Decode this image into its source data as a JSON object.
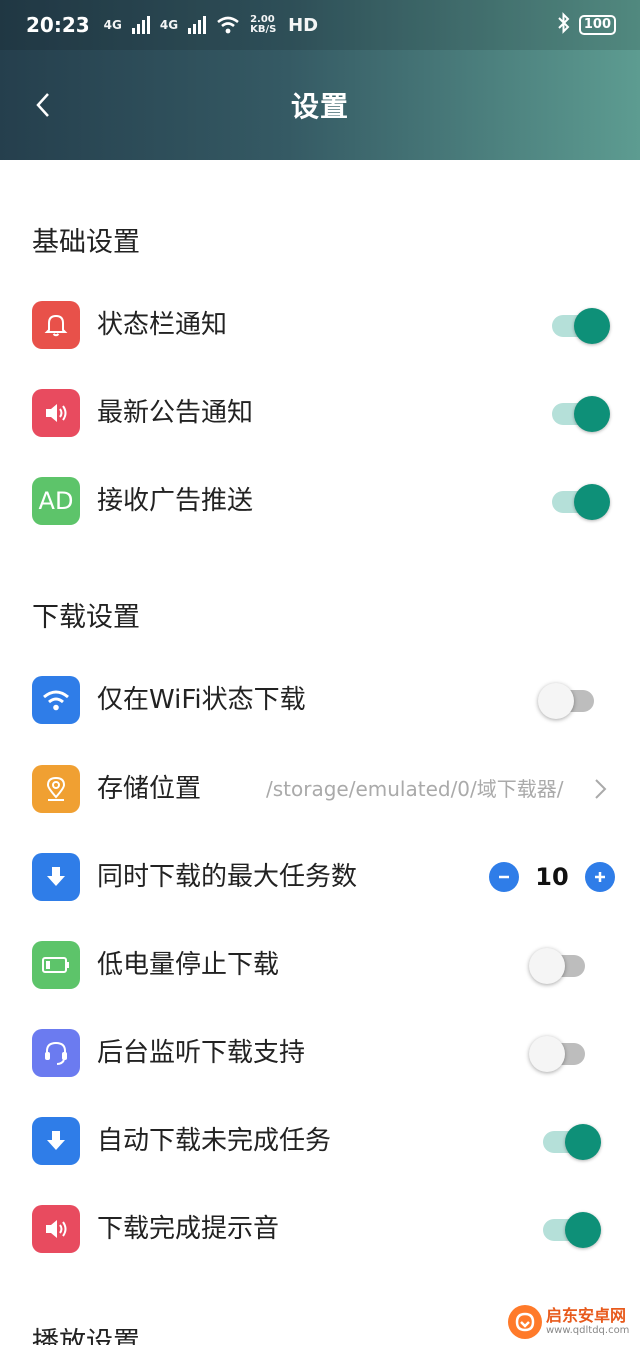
{
  "status_bar": {
    "time": "20:23",
    "signal1": "4G",
    "signal2": "4G",
    "speed": "2.00 KB/S",
    "hd": "HD",
    "battery": "100"
  },
  "header": {
    "title": "设置"
  },
  "sections": {
    "basic": "基础设置",
    "download": "下载设置",
    "playback": "播放设置"
  },
  "basic_items": [
    {
      "label": "状态栏通知",
      "enabled": true
    },
    {
      "label": "最新公告通知",
      "enabled": true
    },
    {
      "label": "接收广告推送",
      "icon_text": "AD",
      "enabled": true
    }
  ],
  "download_items": {
    "wifi_only": {
      "label": "仅在WiFi状态下载",
      "enabled": false
    },
    "storage": {
      "label": "存储位置",
      "value": "/storage/emulated/0/域下载器/"
    },
    "max_tasks": {
      "label": "同时下载的最大任务数",
      "value": "10"
    },
    "low_battery": {
      "label": "低电量停止下载",
      "enabled": false
    },
    "background_listen": {
      "label": "后台监听下载支持",
      "enabled": false
    },
    "auto_resume": {
      "label": "自动下载未完成任务",
      "enabled": true
    },
    "complete_sound": {
      "label": "下载完成提示音",
      "enabled": true
    }
  },
  "watermark": {
    "name": "启东安卓网",
    "url": "www.qdltdq.com"
  },
  "colors": {
    "toggle_on": "#0e9078",
    "icon_red": "#e8514a",
    "icon_pink": "#e84b5f",
    "icon_green": "#5dc46a",
    "icon_blue": "#2f7de8",
    "icon_orange": "#f0a032",
    "icon_indigo": "#6b7bf0"
  }
}
